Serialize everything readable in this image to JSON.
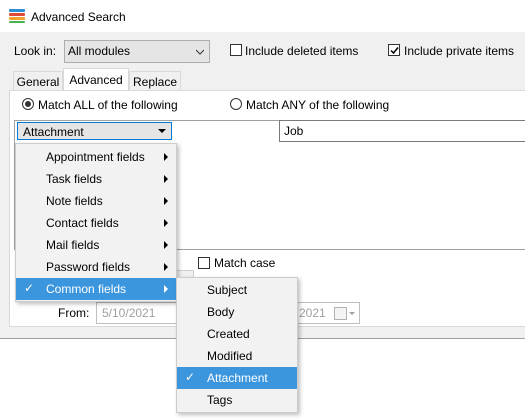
{
  "window": {
    "title": "Advanced Search"
  },
  "lookin": {
    "label": "Look in:",
    "value": "All modules"
  },
  "options": {
    "include_deleted": {
      "label": "Include deleted items",
      "checked": false
    },
    "include_private": {
      "label": "Include private items",
      "checked": true
    }
  },
  "tabs": [
    {
      "label": "General",
      "active": false
    },
    {
      "label": "Advanced",
      "active": true
    },
    {
      "label": "Replace",
      "active": false
    }
  ],
  "match": {
    "all_label": "Match ALL of the following",
    "any_label": "Match ANY of the following",
    "selected": "all"
  },
  "criteria": {
    "field_value": "Attachment",
    "text_value": "Job"
  },
  "match_case": {
    "label": "Match case",
    "checked": false
  },
  "date": {
    "from_label": "From:",
    "from_value": "5/10/2021",
    "to_value_partial": "2021"
  },
  "menu_fields": {
    "items": [
      {
        "label": "Appointment fields",
        "submenu": true,
        "checked": false,
        "selected": false
      },
      {
        "label": "Task fields",
        "submenu": true,
        "checked": false,
        "selected": false
      },
      {
        "label": "Note fields",
        "submenu": true,
        "checked": false,
        "selected": false
      },
      {
        "label": "Contact fields",
        "submenu": true,
        "checked": false,
        "selected": false
      },
      {
        "label": "Mail fields",
        "submenu": true,
        "checked": false,
        "selected": false
      },
      {
        "label": "Password fields",
        "submenu": true,
        "checked": false,
        "selected": false
      },
      {
        "label": "Common fields",
        "submenu": true,
        "checked": true,
        "selected": true
      }
    ]
  },
  "menu_common": {
    "items": [
      {
        "label": "Subject",
        "checked": false,
        "selected": false
      },
      {
        "label": "Body",
        "checked": false,
        "selected": false
      },
      {
        "label": "Created",
        "checked": false,
        "selected": false
      },
      {
        "label": "Modified",
        "checked": false,
        "selected": false
      },
      {
        "label": "Attachment",
        "checked": true,
        "selected": true
      },
      {
        "label": "Tags",
        "checked": false,
        "selected": false
      }
    ]
  },
  "icons": {
    "app": "stacked-lines-icon",
    "check": "✓"
  },
  "colors": {
    "highlight": "#3c96de",
    "focus_border": "#0078d7"
  }
}
